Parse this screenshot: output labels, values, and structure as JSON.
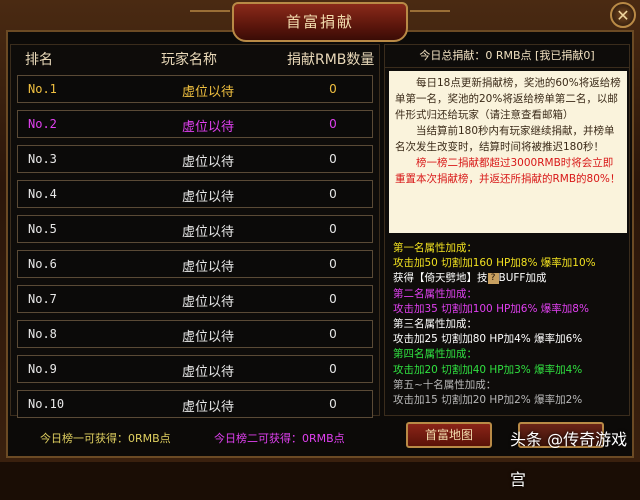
{
  "window": {
    "title": "首富捐献",
    "close_glyph": "✕"
  },
  "table": {
    "headers": {
      "rank": "排名",
      "player": "玩家名称",
      "amount": "捐献RMB数量"
    },
    "rows": [
      {
        "rank": "No.1",
        "name": "虚位以待",
        "amount": "0"
      },
      {
        "rank": "No.2",
        "name": "虚位以待",
        "amount": "0"
      },
      {
        "rank": "No.3",
        "name": "虚位以待",
        "amount": "0"
      },
      {
        "rank": "No.4",
        "name": "虚位以待",
        "amount": "0"
      },
      {
        "rank": "No.5",
        "name": "虚位以待",
        "amount": "0"
      },
      {
        "rank": "No.6",
        "name": "虚位以待",
        "amount": "0"
      },
      {
        "rank": "No.7",
        "name": "虚位以待",
        "amount": "0"
      },
      {
        "rank": "No.8",
        "name": "虚位以待",
        "amount": "0"
      },
      {
        "rank": "No.9",
        "name": "虚位以待",
        "amount": "0"
      },
      {
        "rank": "No.10",
        "name": "虚位以待",
        "amount": "0"
      }
    ]
  },
  "footer": {
    "first_gain": "今日榜一可获得：0RMB点",
    "second_gain": "今日榜二可获得：0RMB点"
  },
  "right": {
    "today_total": "今日总捐献：0 RMB点 [我已捐献0]",
    "rules": [
      {
        "color": "dark",
        "text": "每日18点更新捐献榜，奖池的60%将返给榜单第一名，奖池的20%将返给榜单第二名，以邮件形式归还给玩家（请注意查看邮箱）"
      },
      {
        "color": "dark",
        "text": "当结算前180秒内有玩家继续捐献，并榜单名次发生改变时，结算时间将被推迟180秒！"
      },
      {
        "color": "red",
        "text": "榜一榜二捐献都超过3000RMB时将会立即重置本次捐献榜，并返还所捐献的RMB的80%！"
      }
    ],
    "attrs": [
      {
        "color": "yellow",
        "text": "第一名属性加成："
      },
      {
        "color": "yellow",
        "text": "攻击加50  切割加160   HP加8%  爆率加10%"
      },
      {
        "color": "white",
        "text": "获得【倚天劈地】技",
        "tail": "BUFF加成",
        "q": "?"
      },
      {
        "color": "purple",
        "text": "第二名属性加成："
      },
      {
        "color": "purple",
        "text": "攻击加35  切割加100   HP加6%  爆率加8%"
      },
      {
        "color": "white",
        "text": "第三名属性加成："
      },
      {
        "color": "white",
        "text": "攻击加25  切割加80    HP加4%  爆率加6%"
      },
      {
        "color": "green",
        "text": "第四名属性加成："
      },
      {
        "color": "green",
        "text": "攻击加20  切割加40    HP加3%  爆率加4%"
      },
      {
        "color": "gray",
        "text": "第五~十名属性加成："
      },
      {
        "color": "gray",
        "text": "攻击加15  切割加20    HP加2%  爆率加2%"
      }
    ],
    "map_button": "首富地图"
  },
  "watermark": "头条 @传奇游戏宫"
}
